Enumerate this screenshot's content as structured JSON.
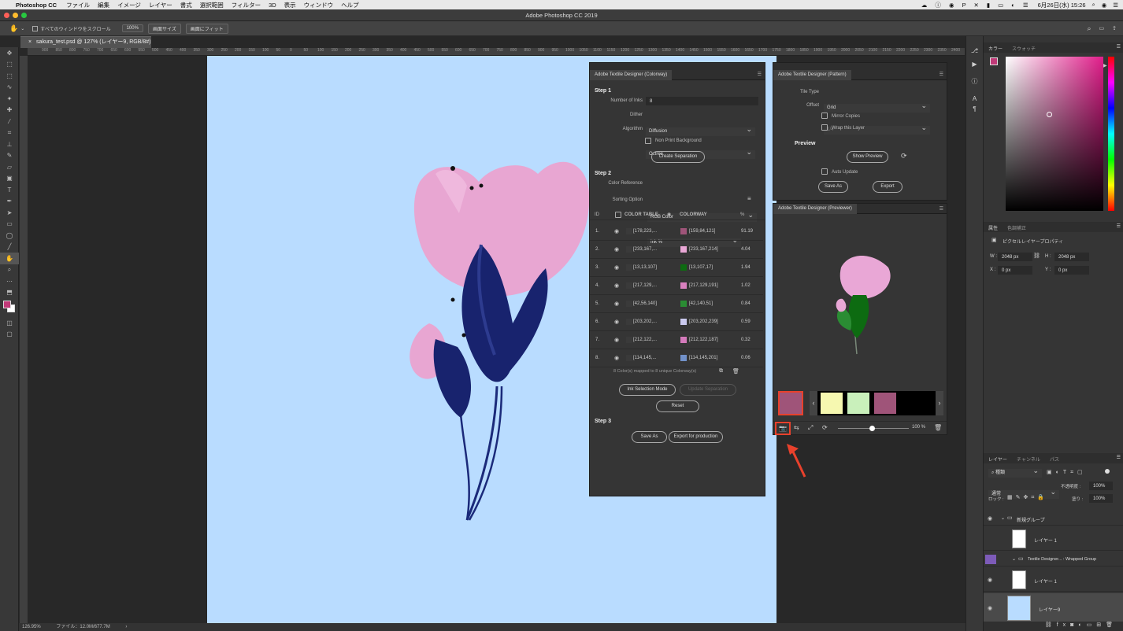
{
  "menubar": {
    "app": "Photoshop CC",
    "items": [
      "ファイル",
      "編集",
      "イメージ",
      "レイヤー",
      "書式",
      "選択範囲",
      "フィルター",
      "3D",
      "表示",
      "ウィンドウ",
      "ヘルプ"
    ],
    "clock": "6月26日(水) 15:26"
  },
  "window_title": "Adobe Photoshop CC 2019",
  "options": {
    "scroll_all": "すべてのウィンドウをスクロール",
    "zoom": "100%",
    "fit_screen": "画面サイズ",
    "fill_screen": "画面にフィット"
  },
  "doc_tab": "sakura_test.psd @ 127% (レイヤー9, RGB/8#) *",
  "ruler_ticks": [
    "900",
    "850",
    "800",
    "750",
    "700",
    "650",
    "600",
    "550",
    "500",
    "450",
    "400",
    "350",
    "300",
    "250",
    "200",
    "150",
    "100",
    "50",
    "0",
    "50",
    "100",
    "150",
    "200",
    "250",
    "300",
    "350",
    "400",
    "450",
    "500",
    "550",
    "600",
    "650",
    "700",
    "750",
    "800",
    "850",
    "900",
    "950",
    "1000",
    "1050",
    "1100",
    "1150",
    "1200",
    "1250",
    "1300",
    "1350",
    "1400",
    "1450",
    "1500",
    "1550",
    "1600",
    "1650",
    "1700",
    "1750",
    "1800",
    "1850",
    "1900",
    "1950",
    "2000",
    "2050",
    "2100",
    "2150",
    "2200",
    "2250",
    "2300",
    "2350",
    "2400",
    "2450",
    "2500"
  ],
  "status": {
    "zoom": "126.95%",
    "file": "ファイル：12.0M/677.7M"
  },
  "colorway_panel": {
    "title": "Adobe Textile Designer (Colorway)",
    "step1": "Step 1",
    "num_inks_label": "Number of Inks",
    "num_inks_value": "8",
    "dither_label": "Dither",
    "dither_value": "Diffusion",
    "algorithm_label": "Algorithm",
    "algorithm_value": "Octree",
    "non_print_bg": "Non Print Background",
    "create_sep": "Create Separation",
    "step2": "Step 2",
    "color_ref_label": "Color Reference",
    "color_ref_value": "RGB Color",
    "sorting_label": "Sorting Option",
    "sorting_value": "Ink %",
    "col_id": "ID",
    "col_table": "COLOR TABLE",
    "col_colorway": "COLORWAY",
    "col_pct": "%",
    "rows": [
      {
        "id": "1.",
        "table": "[178,223,...",
        "colorway": "[159,84,121]",
        "pct": "91.19",
        "swatch": "#9f5479",
        "tswatch": "#b2dfff"
      },
      {
        "id": "2.",
        "table": "[233,167,...",
        "colorway": "[233,167,214]",
        "pct": "4.04",
        "swatch": "#e9a7d6",
        "tswatch": "#e9a7d6"
      },
      {
        "id": "3.",
        "table": "[13,13,107]",
        "colorway": "[13,107,17]",
        "pct": "1.94",
        "swatch": "#0d6b11",
        "tswatch": "#0d0d6b"
      },
      {
        "id": "4.",
        "table": "[217,129,...",
        "colorway": "[217,129,191]",
        "pct": "1.02",
        "swatch": "#d981bf",
        "tswatch": "#d981bf"
      },
      {
        "id": "5.",
        "table": "[42,56,140]",
        "colorway": "[42,140,51]",
        "pct": "0.84",
        "swatch": "#2a8c33",
        "tswatch": "#2a388c"
      },
      {
        "id": "6.",
        "table": "[203,202,...",
        "colorway": "[203,202,239]",
        "pct": "0.59",
        "swatch": "#cbcaef",
        "tswatch": "#cbcaef"
      },
      {
        "id": "7.",
        "table": "[212,122,...",
        "colorway": "[212,122,187]",
        "pct": "0.32",
        "swatch": "#d47abb",
        "tswatch": "#d47abb"
      },
      {
        "id": "8.",
        "table": "[114,145,...",
        "colorway": "[114,145,201]",
        "pct": "0.06",
        "swatch": "#7291c9",
        "tswatch": "#7291c9"
      }
    ],
    "mapping": "8 Color(s) mapped to 8 unique Colorway(s)",
    "ink_sel": "Ink Selection Mode",
    "update_sep": "Update Separation",
    "reset": "Reset",
    "step3": "Step 3",
    "save_as": "Save As",
    "export_prod": "Export for production"
  },
  "pattern_panel": {
    "title": "Adobe Textile Designer (Pattern)",
    "tile_type_label": "Tile Type",
    "tile_type_value": "Grid",
    "offset_label": "Offset",
    "offset_value": "1/4",
    "mirror": "Mirror Copies",
    "wrap": "Wrap this Layer",
    "preview": "Preview",
    "show_preview": "Show Preview",
    "auto_update": "Auto Update",
    "save_as": "Save As",
    "export": "Export"
  },
  "previewer_panel": {
    "title": "Adobe Textile Designer (Previewer)",
    "zoom": "100 %",
    "bg": "#9f5479",
    "thumb_bgs": [
      "#9f5479",
      "#f6f8b0",
      "#c9f0bb",
      "#9f5479",
      "#000000"
    ]
  },
  "right": {
    "color_tab": "カラー",
    "swatch_tab": "スウォッチ",
    "props_tab": "属性",
    "adjust_tab": "色調補正",
    "pixel_props": "ピクセルレイヤープロパティ",
    "w_label": "W :",
    "w_value": "2048 px",
    "h_label": "H :",
    "h_value": "2048 px",
    "x_label": "X :",
    "x_value": "0 px",
    "y_label": "Y :",
    "y_value": "0 px",
    "layers_tab": "レイヤー",
    "channels_tab": "チャンネル",
    "paths_tab": "パス",
    "kind": "種類",
    "blend": "通常",
    "opacity_label": "不透明度 :",
    "opacity_value": "100%",
    "lock_label": "ロック :",
    "fill_label": "塗り :",
    "fill_value": "100%",
    "layers": [
      {
        "name": "新規グループ",
        "type": "group"
      },
      {
        "name": "レイヤー 1",
        "type": "layer"
      },
      {
        "name": "Textile Designer... : Wrapped Group",
        "type": "group"
      },
      {
        "name": "レイヤー 1",
        "type": "layer"
      },
      {
        "name": "レイヤー9",
        "type": "layer"
      }
    ]
  },
  "colors": {
    "canvas_bg": "#b9dcff",
    "highlight": "#e8412c"
  }
}
